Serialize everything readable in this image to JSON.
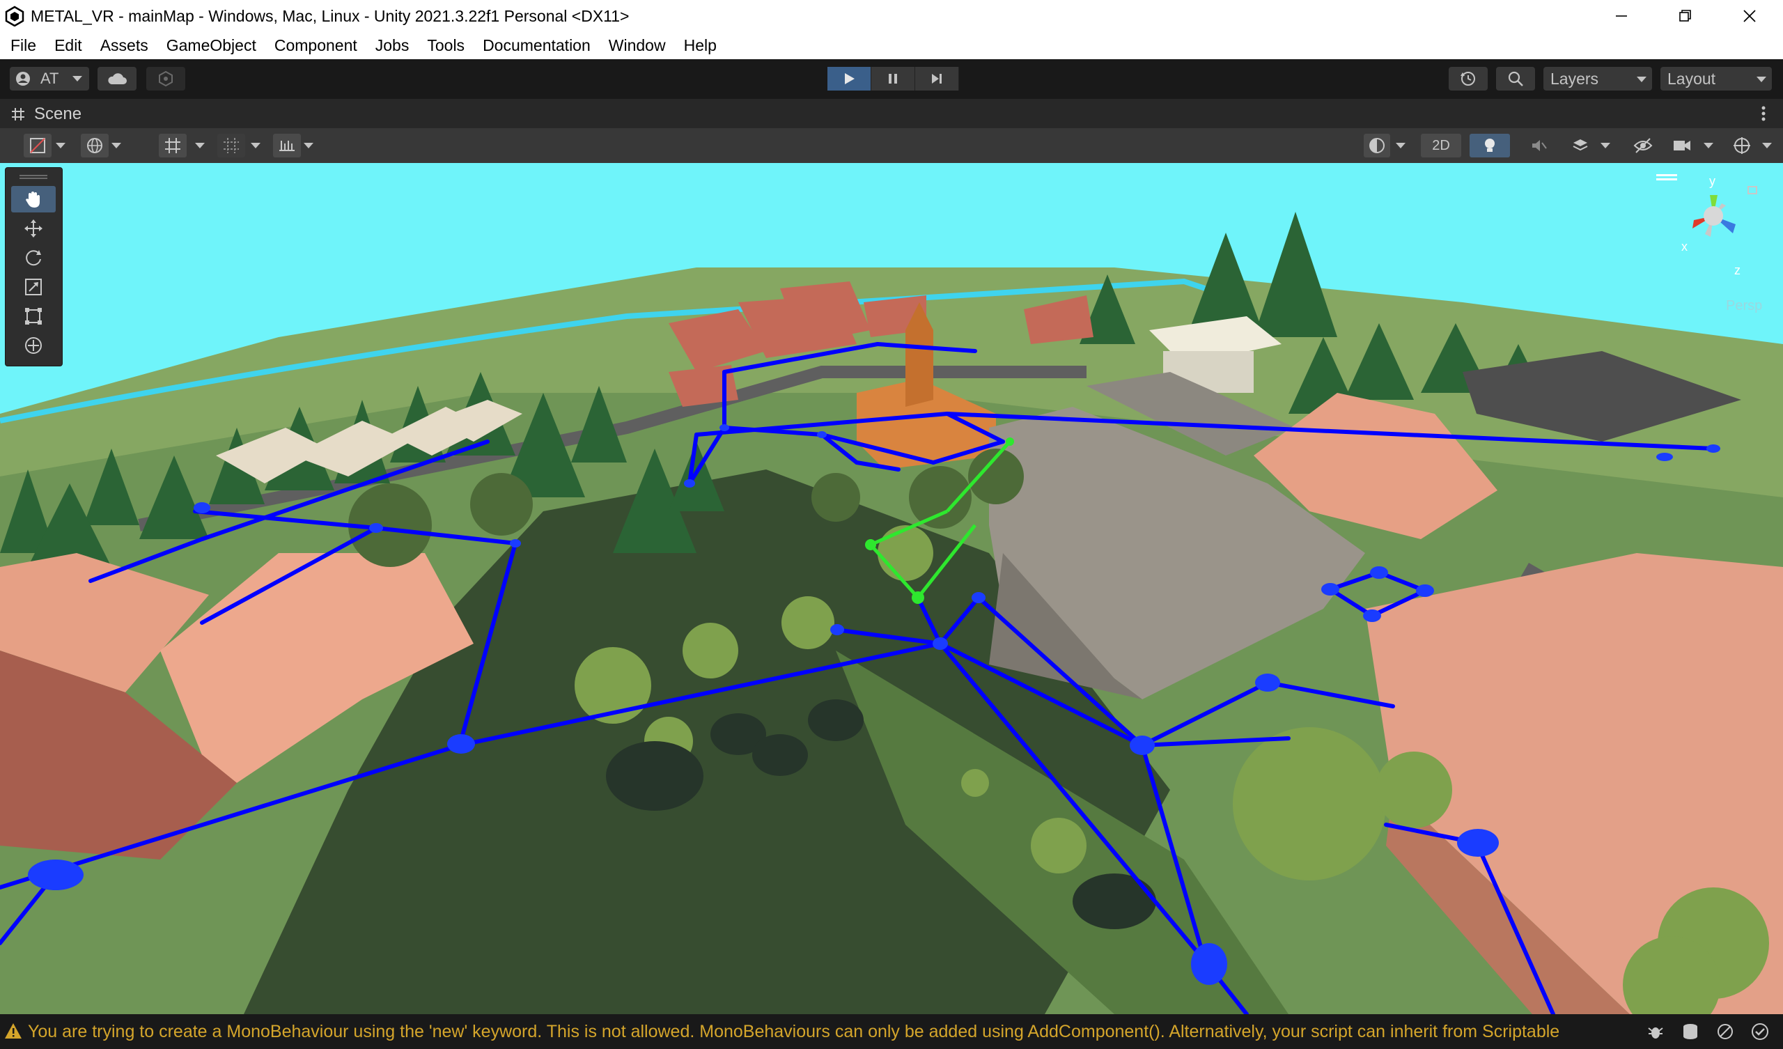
{
  "window": {
    "title": "METAL_VR - mainMap - Windows, Mac, Linux - Unity 2021.3.22f1 Personal <DX11>"
  },
  "menu": [
    "File",
    "Edit",
    "Assets",
    "GameObject",
    "Component",
    "Jobs",
    "Tools",
    "Documentation",
    "Window",
    "Help"
  ],
  "toolbar": {
    "account_label": "AT",
    "layers_label": "Layers",
    "layout_label": "Layout"
  },
  "scene": {
    "tab_label": "Scene",
    "toggle_2d_label": "2D",
    "gizmo_axes": {
      "x": "x",
      "y": "y",
      "z": "z"
    },
    "gizmo_persp_label": "Persp"
  },
  "status": {
    "message": "You are trying to create a MonoBehaviour using the 'new' keyword.  This is not allowed.  MonoBehaviours can only be added using AddComponent(). Alternatively, your script can inherit from Scriptable"
  },
  "colors": {
    "sky": "#6ff4fa",
    "ground": "#6f9556",
    "path": "#0000ff",
    "selected_path": "#2ee82e",
    "warning": "#d4a52b"
  }
}
